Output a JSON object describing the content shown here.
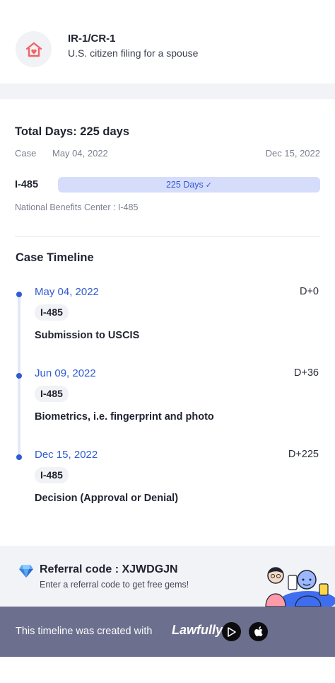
{
  "header": {
    "visa_type": "IR-1/CR-1",
    "visa_desc": "U.S. citizen filing for a spouse",
    "icon": "home-heart-icon"
  },
  "summary": {
    "total": "Total Days: 225 days",
    "case_label": "Case",
    "case_start": "May 04, 2022",
    "case_end": "Dec 15, 2022",
    "form": "I-485",
    "bar_label": "225 Days",
    "bar_icon": "check-icon",
    "center": "National Benefits Center : I-485"
  },
  "timeline": {
    "title": "Case Timeline",
    "events": [
      {
        "date": "May 04, 2022",
        "day": "D+0",
        "tag": "I-485",
        "desc": "Submission to USCIS"
      },
      {
        "date": "Jun 09, 2022",
        "day": "D+36",
        "tag": "I-485",
        "desc": "Biometrics, i.e. fingerprint and photo"
      },
      {
        "date": "Dec 15, 2022",
        "day": "D+225",
        "tag": "I-485",
        "desc": "Decision (Approval or Denial)"
      }
    ]
  },
  "referral": {
    "title": "Referral code : XJWDGJN",
    "subtitle": "Enter a referral code to get free gems!",
    "icon": "gem-icon"
  },
  "footer": {
    "text": "This timeline was created with",
    "brand": "Lawfully",
    "google_play_icon": "google-play-icon",
    "apple_icon": "apple-icon"
  },
  "colors": {
    "accent": "#2f5bd3",
    "bar_fill": "#d6ddfb",
    "footer_bg": "#6c6f8e",
    "brand_dot": "#8b5cf6"
  }
}
